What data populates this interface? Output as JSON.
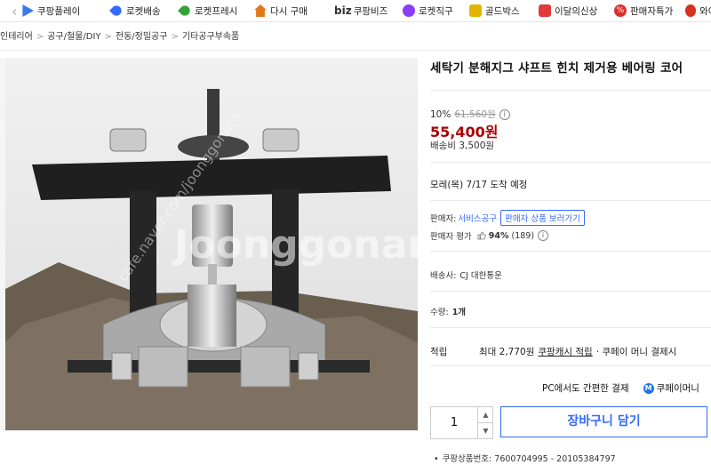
{
  "nav": {
    "items": [
      {
        "label": "쿠팡플레이",
        "icon": "play-icon",
        "color": "#3a7af0"
      },
      {
        "label": "로켓배송",
        "icon": "rocket-icon",
        "color": "#346aff"
      },
      {
        "label": "로켓프레시",
        "icon": "rocket-fresh-icon",
        "color": "#35a13b"
      },
      {
        "label": "다시 구매",
        "icon": "home-icon",
        "color": "#e0791e"
      },
      {
        "label": "쿠팡비즈",
        "prefix": "biz",
        "icon": "biz-icon",
        "color": "#333333"
      },
      {
        "label": "로켓직구",
        "icon": "global-icon",
        "color": "#8b3cf7"
      },
      {
        "label": "골드박스",
        "icon": "gold-box-icon",
        "color": "#e4b400"
      },
      {
        "label": "이달의신상",
        "icon": "new-item-icon",
        "color": "#e23a3a"
      },
      {
        "label": "판매자특가",
        "icon": "percent-icon",
        "color": "#d93030"
      },
      {
        "label": "와이",
        "icon": "wow-icon",
        "color": "#d9301f"
      }
    ]
  },
  "breadcrumb": [
    "인테리어",
    "공구/철물/DIY",
    "전동/정밀공구",
    "기타공구부속품"
  ],
  "product": {
    "title": "세탁기 분해지그 샤프트 힌치 제거용 베어링 코어",
    "watermark": "Joonggonara",
    "watermark_url": "cafe.naver.com/joonggonara",
    "discount_rate": "10%",
    "original_price": "61,560원",
    "sale_price": "55,400원",
    "shipping_fee": "배송비 3,500원",
    "delivery_date": "모레(목) 7/17 도착 예정",
    "seller_label": "판매자:",
    "seller_name": "서비스공구",
    "seller_button": "판매자 상품 보러가기",
    "rating_label": "판매자 평가",
    "rating_value": "94%",
    "rating_count": "(189)",
    "carrier_label": "배송사:",
    "carrier": "CJ 대한통운",
    "quantity_label": "수량:",
    "quantity_text": "1개",
    "cash_label": "적립",
    "cash_amount": "최대 2,770원",
    "cash_link": "쿠팡캐시 적립",
    "cash_tail": "· 쿠페이 머니 결제시",
    "pc_pay": "PC에서도 간편한 결제",
    "pay_brand": "쿠페이머니",
    "quantity_value": "1",
    "cart_label": "장바구니 담기",
    "product_code": "쿠팡상품번호: 7600704995 - 20105384797"
  },
  "colors": {
    "price": "#ae0000",
    "accent": "#346aff"
  }
}
